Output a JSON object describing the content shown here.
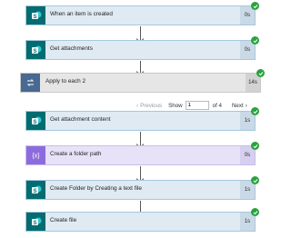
{
  "steps": [
    {
      "title": "When an item is created",
      "duration": "0s",
      "icon": "sharepoint-icon"
    },
    {
      "title": "Get attachments",
      "duration": "0s",
      "icon": "sharepoint-icon"
    },
    {
      "title": "Apply to each 2",
      "duration": "14s",
      "icon": "loop-icon"
    },
    {
      "title": "Get attachment content",
      "duration": "1s",
      "icon": "sharepoint-icon"
    },
    {
      "title": "Create a folder path",
      "duration": "0s",
      "icon": "compose-icon"
    },
    {
      "title": "Create Folder by Creating a text file",
      "duration": "1s",
      "icon": "sharepoint-icon"
    },
    {
      "title": "Create file",
      "duration": "1s",
      "icon": "sharepoint-icon"
    }
  ],
  "pager": {
    "previous_label": "Previous",
    "show_label": "Show",
    "page_value": "1",
    "of_label": "of 4",
    "next_label": "Next"
  },
  "colors": {
    "sharepoint": "#036c70",
    "loop": "#486991",
    "compose": "#8c6cdd",
    "success": "#2aa33f"
  }
}
